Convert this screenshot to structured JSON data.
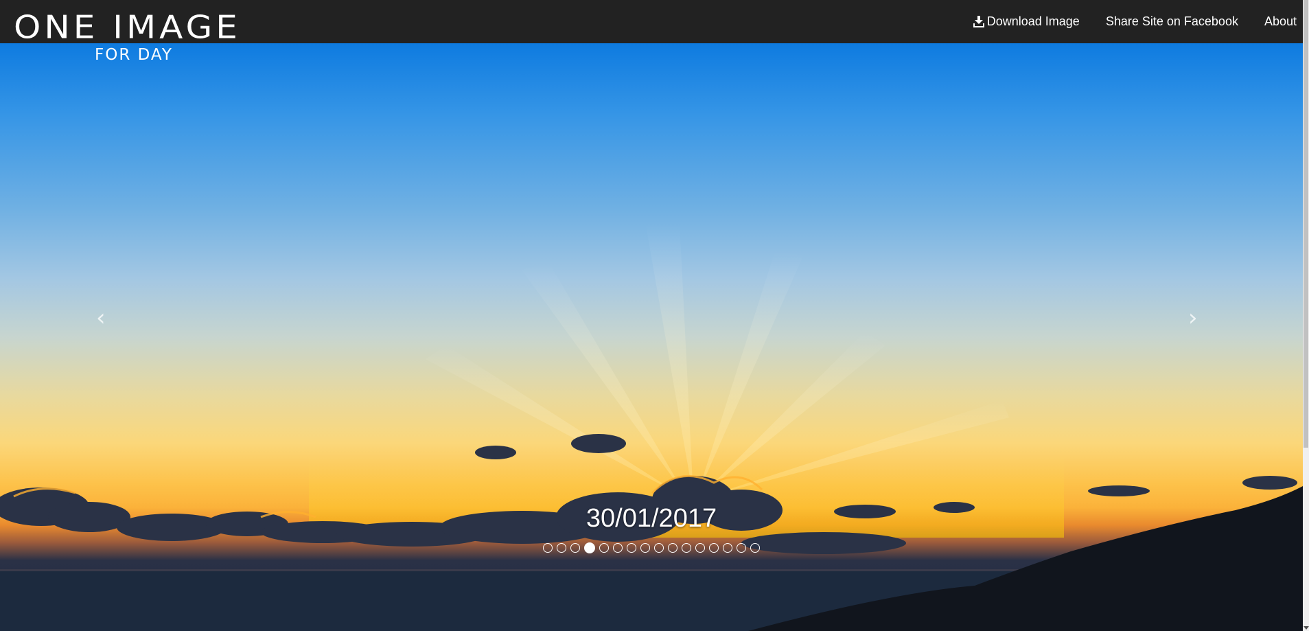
{
  "brand": {
    "title": "ONE IMAGE",
    "subtitle": "FOR DAY"
  },
  "nav": {
    "download_label": "Download Image",
    "share_label": "Share Site on Facebook",
    "about_label": "About",
    "download_icon": "download-icon"
  },
  "carousel": {
    "prev_glyph": "‹",
    "next_glyph": "›",
    "date": "30/01/2017",
    "indicator_count": 16,
    "active_index": 3
  },
  "colors": {
    "navbar_bg": "#222222",
    "text": "#ffffff",
    "sky_top": "#0e7be0",
    "horizon": "#fdc24a",
    "sea": "#1f2c40"
  }
}
